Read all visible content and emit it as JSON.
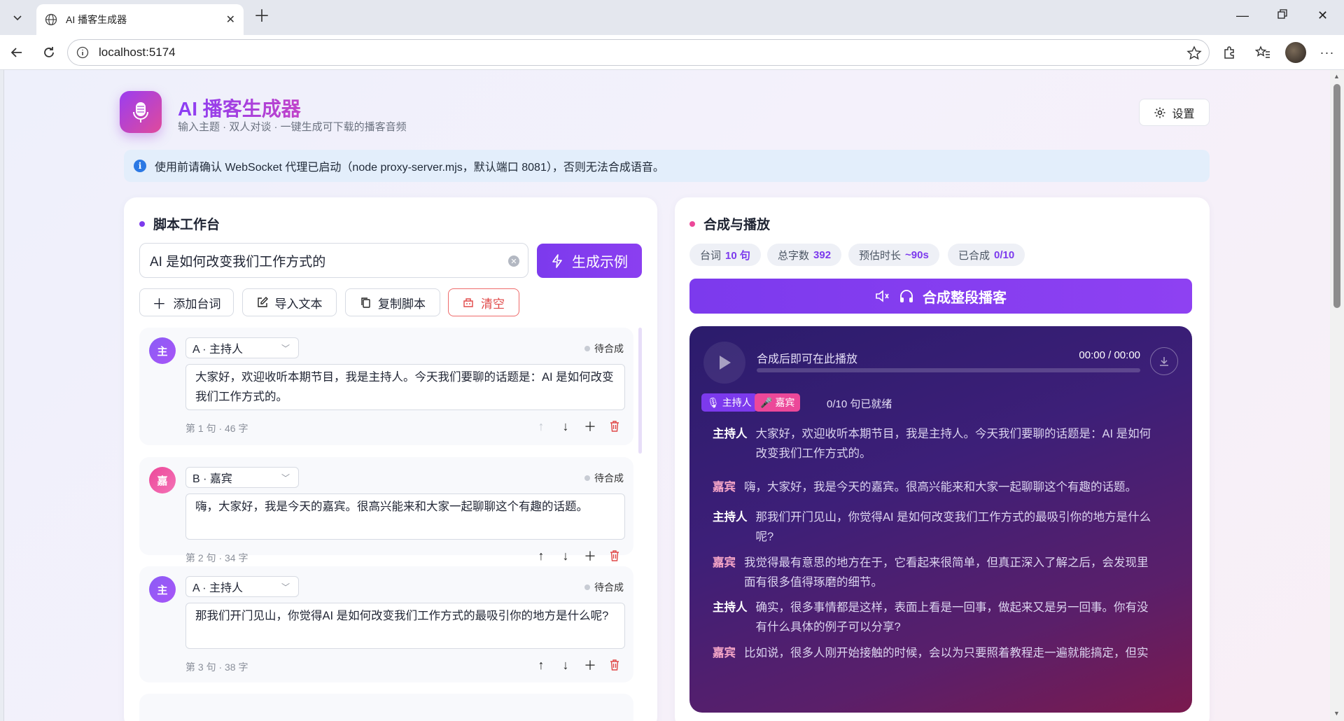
{
  "browser": {
    "tab_title": "AI 播客生成器",
    "url": "localhost:5174"
  },
  "header": {
    "title": "AI 播客生成器",
    "subtitle": "输入主题 · 双人对谈 · 一键生成可下载的播客音频",
    "settings_label": "设置"
  },
  "notice": {
    "text": "使用前请确认 WebSocket 代理已启动（node proxy-server.mjs，默认端口 8081），否则无法合成语音。"
  },
  "workbench": {
    "title": "脚本工作台",
    "topic_value": "AI 是如何改变我们工作方式的",
    "generate_label": "生成示例",
    "buttons": {
      "add": "添加台词",
      "import": "导入文本",
      "copy": "复制脚本",
      "clear": "清空"
    },
    "lines": [
      {
        "avatar": "主",
        "speaker": "A · 主持人",
        "status": "待合成",
        "text": "大家好，欢迎收听本期节目，我是主持人。今天我们要聊的话题是：AI 是如何改变我们工作方式的。",
        "meta": "第 1 句 · 46 字"
      },
      {
        "avatar": "嘉",
        "speaker": "B · 嘉宾",
        "status": "待合成",
        "text": "嗨，大家好，我是今天的嘉宾。很高兴能来和大家一起聊聊这个有趣的话题。",
        "meta": "第 2 句 · 34 字"
      },
      {
        "avatar": "主",
        "speaker": "A · 主持人",
        "status": "待合成",
        "text": "那我们开门见山，你觉得AI 是如何改变我们工作方式的最吸引你的地方是什么呢?",
        "meta": "第 3 句 · 38 字"
      }
    ]
  },
  "synthesis": {
    "title": "合成与播放",
    "chips": [
      {
        "label": "台词",
        "value": "10 句"
      },
      {
        "label": "总字数",
        "value": "392"
      },
      {
        "label": "预估时长",
        "value": "~90s"
      },
      {
        "label": "已合成",
        "value": "0/10"
      }
    ],
    "synth_label": "合成整段播客",
    "player": {
      "label": "合成后即可在此播放",
      "time": "00:00 / 00:00",
      "progress": 0,
      "tag_host": "主持人",
      "tag_guest": "嘉宾",
      "ready_text": "0/10 句已就绪"
    },
    "transcript": [
      {
        "who": "主持人",
        "role": "host",
        "text": "大家好，欢迎收听本期节目，我是主持人。今天我们要聊的话题是：AI 是如何改变我们工作方式的。"
      },
      {
        "who": "嘉宾",
        "role": "guest",
        "text": "嗨，大家好，我是今天的嘉宾。很高兴能来和大家一起聊聊这个有趣的话题。"
      },
      {
        "who": "主持人",
        "role": "host",
        "text": "那我们开门见山，你觉得AI 是如何改变我们工作方式的最吸引你的地方是什么呢?"
      },
      {
        "who": "嘉宾",
        "role": "guest",
        "text": "我觉得最有意思的地方在于，它看起来很简单，但真正深入了解之后，会发现里面有很多值得琢磨的细节。"
      },
      {
        "who": "主持人",
        "role": "host",
        "text": "确实，很多事情都是这样，表面上看是一回事，做起来又是另一回事。你有没有什么具体的例子可以分享?"
      },
      {
        "who": "嘉宾",
        "role": "guest",
        "text": "比如说，很多人刚开始接触的时候，会以为只要照着教程走一遍就能搞定，但实"
      }
    ]
  },
  "colors": {
    "accent": "#7c3aed",
    "host": "#8b5cf6",
    "guest": "#ec4899",
    "danger": "#e04848"
  }
}
